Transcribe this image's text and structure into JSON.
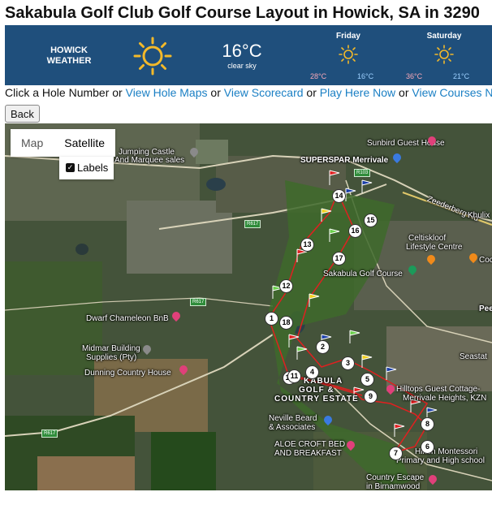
{
  "page": {
    "title": "Sakabula Golf Club Golf Course Layout in Howick, SA in 3290"
  },
  "weather": {
    "city_line1": "HOWICK",
    "city_line2": "WEATHER",
    "current_temp": "16°C",
    "current_desc": "clear sky",
    "days": [
      {
        "name": "Friday",
        "high": "28°C",
        "low": "16°C"
      },
      {
        "name": "Saturday",
        "high": "36°C",
        "low": "21°C"
      }
    ],
    "colors": {
      "banner": "#1f4f7c",
      "sun": "#f3b92a",
      "high": "#f8a8b8",
      "low": "#9cd0ff"
    }
  },
  "nav": {
    "prefix": "Click a Hole Number or ",
    "link1": "View Hole Maps",
    "or1": " or ",
    "link2": "View Scorecard",
    "or2": " or ",
    "link3": "Play Here Now",
    "or3": " or ",
    "link4": "View Courses Near"
  },
  "back_button": "Back",
  "map": {
    "type_map": "Map",
    "type_satellite": "Satellite",
    "labels_checkbox": "Labels",
    "places": {
      "jumping_castle_1": "Jumping Castle",
      "jumping_castle_2": "And Marquee sales",
      "sunbird": "Sunbird Guest House",
      "superspar": "SUPERSPAR Merrivale",
      "zeederberg": "Zeederberg Rd",
      "khulix": "Khulix",
      "celtiskloof_1": "Celtiskloof",
      "celtiskloof_2": "Lifestyle Centre",
      "coc": "Coc",
      "sakabula": "Sakabula Golf Course",
      "peel": "Peel",
      "dwarf": "Dwarf Chameleon BnB",
      "midmar_1": "Midmar Building",
      "midmar_2": "Supplies (Pty)",
      "dunning": "Dunning Country House",
      "seastat": "Seastat",
      "estate_1": "KABULA",
      "estate_2": "GOLF &",
      "estate_3": "COUNTRY ESTATE",
      "hilltops_1": "Hilltops Guest Cottage-",
      "hilltops_2": "Merrivale Heights, KZN",
      "neville_1": "Neville Beard",
      "neville_2": "& Associates",
      "aloe_1": "ALOE CROFT BED",
      "aloe_2": "AND BREAKFAST",
      "hilton_1": "Hilton Montessori",
      "hilton_2": "Primary and High school",
      "escape_1": "Country Escape",
      "escape_2": "in Birnamwood",
      "r103": "R103",
      "r617a": "R617",
      "r617b": "R617",
      "r617c": "R617"
    },
    "holes": [
      "1",
      "2",
      "3",
      "4",
      "5",
      "6",
      "7",
      "8",
      "9",
      "10",
      "11",
      "12",
      "13",
      "14",
      "15",
      "16",
      "17",
      "18"
    ]
  }
}
